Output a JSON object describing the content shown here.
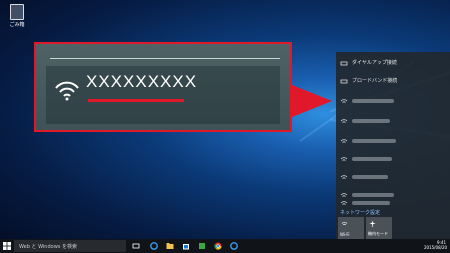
{
  "desktop": {
    "recycle_bin_label": "ごみ箱"
  },
  "zoom_callout": {
    "ssid": "XXXXXXXXX"
  },
  "network_flyout": {
    "items": [
      {
        "label": "ダイヤルアップ接続",
        "icon": "dialup-icon"
      },
      {
        "label": "ブロードバンド接続",
        "icon": "dialup-icon"
      }
    ],
    "wifi_count": 7,
    "settings_link": "ネットワーク設定",
    "tiles": [
      {
        "label": "Wi-Fi",
        "icon": "wifi-icon"
      },
      {
        "label": "機内モード",
        "icon": "airplane-icon"
      }
    ]
  },
  "taskbar": {
    "search_placeholder": "Web と Windows を検索",
    "clock_time": "9:41",
    "clock_date": "2015/08/20"
  },
  "colors": {
    "highlight": "#e0182a",
    "panel": "#22282e",
    "link": "#8fc4ff"
  }
}
